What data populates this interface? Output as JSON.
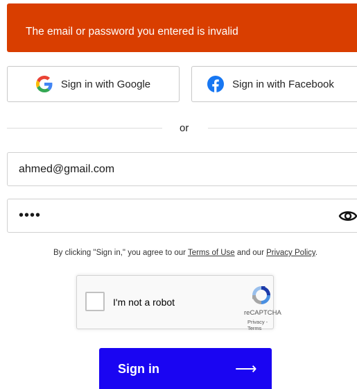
{
  "error": {
    "message": "The email or password you entered is invalid",
    "background_color": "#d93e00"
  },
  "social": {
    "google_label": "Sign in with Google",
    "google_icon": "google-icon",
    "facebook_label": "Sign in with Facebook",
    "facebook_icon": "facebook-icon",
    "facebook_color": "#1877f2"
  },
  "divider_text": "or",
  "form": {
    "email_value": "ahmed@gmail.com",
    "password_value": "••••",
    "password_toggle_icon": "eye-icon"
  },
  "terms": {
    "prefix": "By clicking \"Sign in,\" you agree to our ",
    "terms_link": "Terms of Use",
    "middle": " and our ",
    "privacy_link": "Privacy Policy",
    "suffix": "."
  },
  "recaptcha": {
    "label": "I'm not a robot",
    "brand": "reCAPTCHA",
    "privacy": "Privacy",
    "separator": " - ",
    "terms": "Terms",
    "checked": false
  },
  "submit": {
    "label": "Sign in",
    "arrow": "⟶",
    "color": "#1a05f2"
  }
}
